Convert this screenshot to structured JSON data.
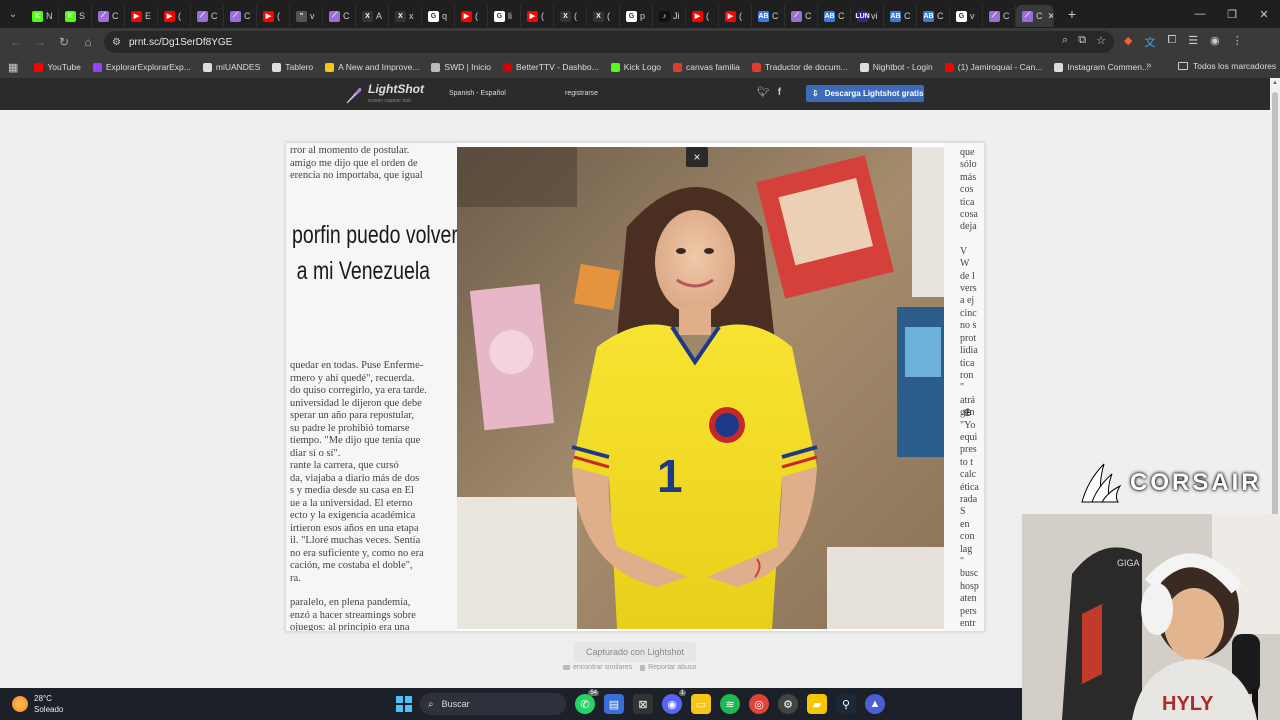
{
  "browser": {
    "tabs": [
      {
        "label": "N",
        "fav": "#53fc18",
        "glyph": "K"
      },
      {
        "label": "S",
        "fav": "#53fc18",
        "glyph": "K"
      },
      {
        "label": "C",
        "fav": "#9b6fd6",
        "glyph": "⟋"
      },
      {
        "label": "E",
        "fav": "#ff0000",
        "glyph": "▶"
      },
      {
        "label": "(",
        "fav": "#ff0000",
        "glyph": "▶"
      },
      {
        "label": "C",
        "fav": "#9b6fd6",
        "glyph": "⟋"
      },
      {
        "label": "C",
        "fav": "#9b6fd6",
        "glyph": "⟋"
      },
      {
        "label": "(",
        "fav": "#ff0000",
        "glyph": "▶"
      },
      {
        "label": "v",
        "fav": "#555555",
        "glyph": "\""
      },
      {
        "label": "C",
        "fav": "#9b6fd6",
        "glyph": "⟋"
      },
      {
        "label": "A",
        "fav": "#333333",
        "glyph": "X"
      },
      {
        "label": "x",
        "fav": "#333333",
        "glyph": "X"
      },
      {
        "label": "q",
        "fav": "#ffffff",
        "glyph": "G"
      },
      {
        "label": "(",
        "fav": "#ff0000",
        "glyph": "▶"
      },
      {
        "label": "li",
        "fav": "#ffffff",
        "glyph": "G"
      },
      {
        "label": "(",
        "fav": "#ff0000",
        "glyph": "▶"
      },
      {
        "label": "(",
        "fav": "#333333",
        "glyph": "X"
      },
      {
        "label": "(",
        "fav": "#333333",
        "glyph": "X"
      },
      {
        "label": "p",
        "fav": "#ffffff",
        "glyph": "G"
      },
      {
        "label": "Ji",
        "fav": "#111111",
        "glyph": "♪"
      },
      {
        "label": "(",
        "fav": "#ff0000",
        "glyph": "▶"
      },
      {
        "label": "(",
        "fav": "#ff0000",
        "glyph": "▶"
      },
      {
        "label": "C",
        "fav": "#3d7bd9",
        "glyph": "AB"
      },
      {
        "label": "C",
        "fav": "#9b6fd6",
        "glyph": "⟋"
      },
      {
        "label": "C",
        "fav": "#3d7bd9",
        "glyph": "AB"
      },
      {
        "label": "vi",
        "fav": "#2b2b8a",
        "glyph": "LUN"
      },
      {
        "label": "C",
        "fav": "#3d7bd9",
        "glyph": "AB"
      },
      {
        "label": "C",
        "fav": "#3d7bd9",
        "glyph": "AB"
      },
      {
        "label": "v",
        "fav": "#ffffff",
        "glyph": "G"
      },
      {
        "label": "C",
        "fav": "#9b6fd6",
        "glyph": "⟋"
      }
    ],
    "active_tab": {
      "label": "C",
      "fav": "#9b6fd6",
      "glyph": "⟋"
    },
    "new_tab": "+",
    "url": "prnt.sc/Dg1SerDf8YGE",
    "bookmarks": [
      {
        "label": "YouTube",
        "color": "#ff0000"
      },
      {
        "label": "ExplorarExplorarExp...",
        "color": "#9146ff"
      },
      {
        "label": "miUANDES",
        "color": "#dddddd"
      },
      {
        "label": "Tablero",
        "color": "#dddddd"
      },
      {
        "label": "A New and Improve...",
        "color": "#f5c518"
      },
      {
        "label": "SWD | Inicio",
        "color": "#bbbbbb"
      },
      {
        "label": "BetterTTV - Dashbo...",
        "color": "#d50000"
      },
      {
        "label": "Kick Logo",
        "color": "#53fc18"
      },
      {
        "label": "canvas familia",
        "color": "#e03e2d"
      },
      {
        "label": "Traductor de docum...",
        "color": "#e03e2d"
      },
      {
        "label": "Nightbot - Login",
        "color": "#dddddd"
      },
      {
        "label": "(1) Jamiroquai - Can...",
        "color": "#ff0000"
      },
      {
        "label": "Instagram Commen...",
        "color": "#dddddd"
      }
    ],
    "bookmarks_more": "»",
    "all_bookmarks": "Todos los marcadores"
  },
  "lightshot": {
    "logo": "LightShot",
    "logo_sub": "screen capture tool",
    "language": "Spanish - Español",
    "register": "registrarse",
    "download": "Descarga Lightshot gratis",
    "close": "×",
    "captured_with": "Capturado con Lightshot",
    "find_similar": "encontrar similares",
    "report_abuse": "Reportar abuso"
  },
  "screenshot": {
    "news_top": [
      "rror al momento de postular.",
      "amigo me dijo que el orden de",
      "erencia no importaba, que igual"
    ],
    "headline": [
      "porfin puedo volver",
      "a mi Venezuela"
    ],
    "news_bottom": [
      "quedar en todas. Puse Enferme-",
      "rmero y ahí quedé\", recuerda.",
      "do quiso corregirlo, ya era tarde.",
      "universidad le dijeron que debe",
      "sperar un año para repostular,",
      " su padre le prohibió tomarse",
      "tiempo. \"Me dijo que tenía que",
      "diar sí o sí\".",
      "rante la carrera, que cursó",
      "da, viajaba a diario más de dos",
      "s y media desde su casa en El",
      "ue a la universidad. El eterno",
      "ecto y la exigencia académica",
      "irtieron esos años en una etapa",
      "il. \"Lloré muchas veces. Sentía",
      "no era suficiente y, como no era",
      "cación, me costaba el doble\",",
      "ra.",
      "",
      " paralelo, en plena pandemia,",
      "enzó a hacer streamings sobre",
      "ojuegos: al principio era una"
    ],
    "news_right": [
      "que",
      "sólo",
      "más",
      "cos",
      "tica",
      "cosa",
      "deja",
      "",
      "V",
      "W",
      "de l",
      "vers",
      "a ej",
      "cinc",
      "no s",
      "prot",
      "lidia",
      "tica",
      "ron",
      "\"",
      "atrá",
      "gén",
      "\"Yo",
      "equi",
      "pres",
      "to t",
      "calc",
      "ética",
      "rada",
      "S",
      "en",
      "con",
      "lag",
      "\"",
      "busc",
      "hosp",
      "aten",
      "pers",
      "entr"
    ],
    "jersey_number": "1"
  },
  "overlay": {
    "sponsor": "CORSAIR"
  },
  "taskbar": {
    "temperature": "28°C",
    "weather": "Soleado",
    "search_placeholder": "Buscar",
    "whatsapp_badge": "54",
    "discord_badge": "1"
  }
}
